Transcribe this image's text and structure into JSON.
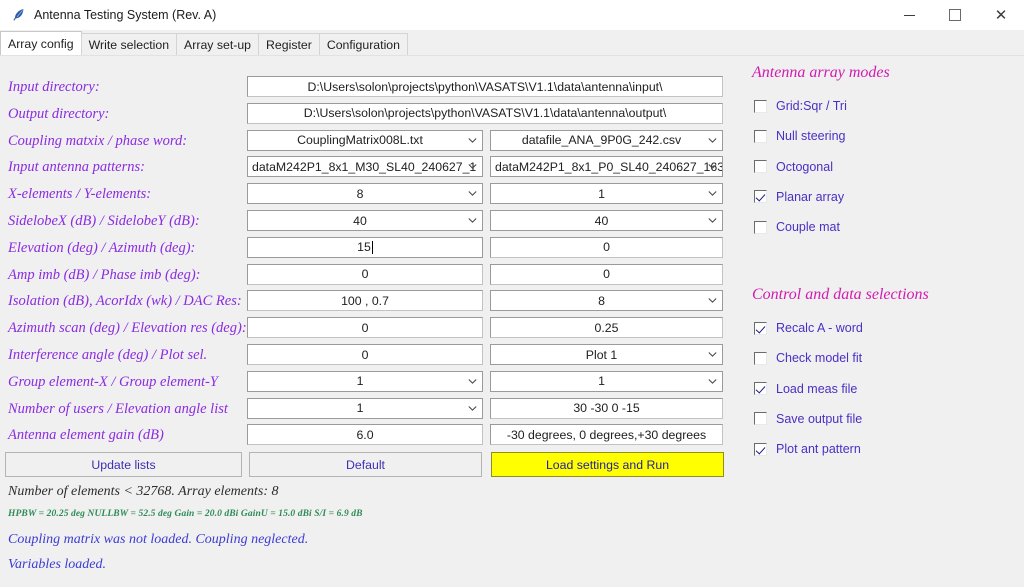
{
  "window": {
    "title": "Antenna Testing System (Rev. A)",
    "icon": "feather-icon",
    "minimize": "—",
    "maximize": "□",
    "close": "✕"
  },
  "tabs": [
    {
      "label": "Array config",
      "active": true
    },
    {
      "label": "Write selection",
      "active": false
    },
    {
      "label": "Array set-up",
      "active": false
    },
    {
      "label": "Register",
      "active": false
    },
    {
      "label": "Configuration",
      "active": false
    }
  ],
  "form": {
    "rows": [
      {
        "label": "Input directory:",
        "span": "full",
        "left": {
          "type": "entry",
          "value": "D:\\Users\\solon\\projects\\python\\VASATS\\V1.1\\data\\antenna\\input\\"
        }
      },
      {
        "label": "Output directory:",
        "span": "full",
        "left": {
          "type": "entry",
          "value": "D:\\Users\\solon\\projects\\python\\VASATS\\V1.1\\data\\antenna\\output\\"
        }
      },
      {
        "label": "Coupling matxix / phase word:",
        "span": "split",
        "left": {
          "type": "combo",
          "value": "CouplingMatrix008L.txt"
        },
        "right": {
          "type": "combo",
          "value": "datafile_ANA_9P0G_242.csv"
        }
      },
      {
        "label": "Input antenna patterns:",
        "span": "split",
        "left": {
          "type": "combo",
          "value": "dataM242P1_8x1_M30_SL40_240627_1",
          "align": "left"
        },
        "right": {
          "type": "combo",
          "value": "dataM242P1_8x1_P0_SL40_240627_163",
          "align": "left"
        }
      },
      {
        "label": "X-elements / Y-elements:",
        "span": "split",
        "left": {
          "type": "combo",
          "value": "8"
        },
        "right": {
          "type": "combo",
          "value": "1"
        }
      },
      {
        "label": "SidelobeX (dB) / SidelobeY (dB):",
        "span": "split",
        "left": {
          "type": "combo",
          "value": "40"
        },
        "right": {
          "type": "combo",
          "value": "40"
        }
      },
      {
        "label": "Elevation (deg) / Azimuth (deg):",
        "span": "split",
        "left": {
          "type": "entry",
          "value": "15",
          "focused": true
        },
        "right": {
          "type": "entry",
          "value": "0"
        }
      },
      {
        "label": "Amp imb (dB) / Phase imb (deg):",
        "span": "split",
        "left": {
          "type": "entry",
          "value": "0"
        },
        "right": {
          "type": "entry",
          "value": "0"
        }
      },
      {
        "label": "Isolation (dB), AcorIdx (wk) / DAC Res:",
        "span": "split",
        "left": {
          "type": "entry",
          "value": "100 , 0.7"
        },
        "right": {
          "type": "combo",
          "value": "8"
        }
      },
      {
        "label": "Azimuth scan (deg) / Elevation res (deg):",
        "span": "split",
        "left": {
          "type": "entry",
          "value": "0"
        },
        "right": {
          "type": "entry",
          "value": "0.25"
        }
      },
      {
        "label": "Interference angle (deg) / Plot sel.",
        "span": "split",
        "left": {
          "type": "entry",
          "value": "0"
        },
        "right": {
          "type": "combo",
          "value": "Plot 1"
        }
      },
      {
        "label": "Group element-X / Group element-Y",
        "span": "split",
        "left": {
          "type": "combo",
          "value": "1"
        },
        "right": {
          "type": "combo",
          "value": "1"
        }
      },
      {
        "label": "Number of users / Elevation angle list",
        "span": "split",
        "left": {
          "type": "combo",
          "value": "1"
        },
        "right": {
          "type": "entry",
          "value": "30 -30 0 -15"
        }
      },
      {
        "label": "Antenna element gain (dB)",
        "span": "split",
        "left": {
          "type": "entry",
          "value": "6.0"
        },
        "right": {
          "type": "entry",
          "value": "-30 degrees, 0 degrees,+30 degrees"
        }
      }
    ]
  },
  "buttons": {
    "update_lists": "Update lists",
    "default": "Default",
    "run": "Load settings and Run"
  },
  "status": {
    "elements": "Number of elements < 32768. Array elements: 8",
    "metrics": "HPBW = 20.25 deg  NULLBW = 52.5 deg  Gain = 20.0 dBi  GainU = 15.0 dBi   S/I = 6.9 dB",
    "message1": "Coupling matrix was not loaded. Coupling neglected.",
    "message2": "Variables loaded."
  },
  "panels": [
    {
      "title": "Antenna array modes",
      "items": [
        {
          "label": "Grid:Sqr / Tri",
          "checked": false
        },
        {
          "label": "Null steering",
          "checked": false
        },
        {
          "label": "Octogonal",
          "checked": false
        },
        {
          "label": "Planar array",
          "checked": true
        },
        {
          "label": "Couple mat",
          "checked": false
        }
      ]
    },
    {
      "title": "Control and data selections",
      "items": [
        {
          "label": "Recalc A - word",
          "checked": true
        },
        {
          "label": "Check model fit",
          "checked": false
        },
        {
          "label": "Load meas file",
          "checked": true
        },
        {
          "label": "Save output file",
          "checked": false
        },
        {
          "label": "Plot ant pattern",
          "checked": true
        }
      ]
    }
  ],
  "colors": {
    "label_purple": "#8a2be2",
    "group_title_magenta": "#d11bb0",
    "checkbox_label": "#4b2fc4",
    "run_button_bg": "#ffff00",
    "metrics_green": "#2e8b57",
    "message_blue": "#3b3bd4"
  }
}
